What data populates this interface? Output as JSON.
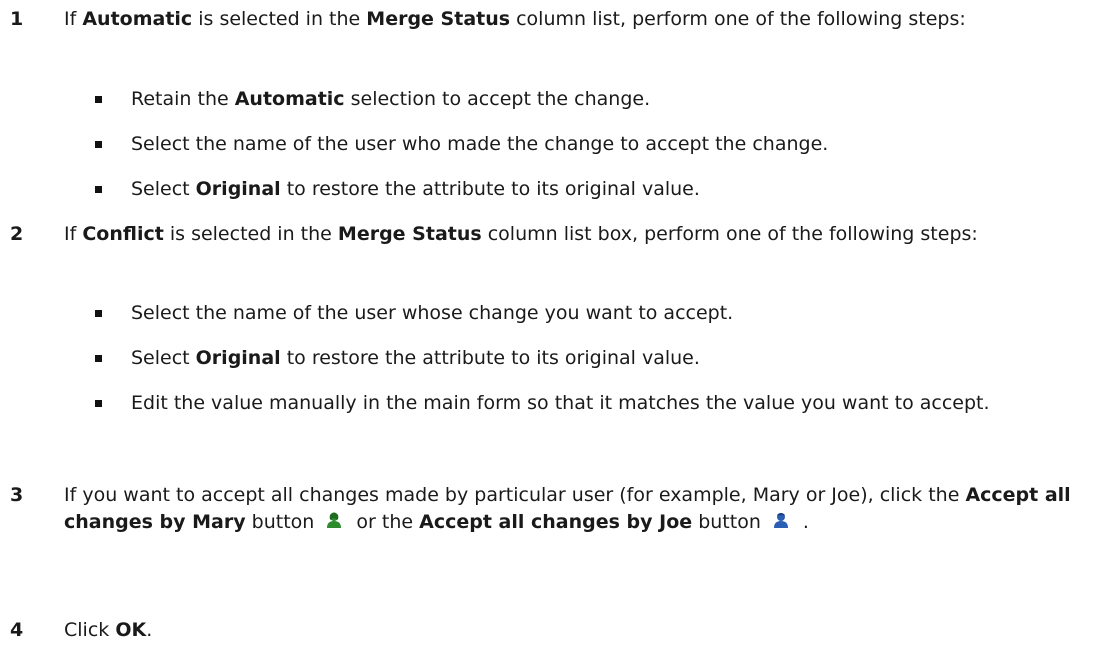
{
  "steps": [
    {
      "number": "1",
      "parts": [
        "If ",
        "Automatic",
        " is selected in the ",
        "Merge Status",
        " column list, perform one of the following steps:"
      ],
      "bullets": [
        {
          "parts": [
            "Retain the ",
            "Automatic",
            " selection to accept the change."
          ]
        },
        {
          "parts": [
            "Select the name of the user who made the change to accept the change."
          ]
        },
        {
          "parts": [
            "Select ",
            "Original",
            " to restore the attribute to its original value."
          ]
        }
      ]
    },
    {
      "number": "2",
      "parts": [
        "If ",
        "Conflict",
        " is selected in the ",
        "Merge Status",
        " column list box, perform one of the following steps:"
      ],
      "bullets": [
        {
          "parts": [
            "Select the name of the user whose change you want to accept."
          ]
        },
        {
          "parts": [
            "Select ",
            "Original",
            " to restore the attribute to its original value."
          ]
        },
        {
          "parts": [
            "Edit the value manually in the main form so that it matches the value you want to accept."
          ]
        }
      ]
    },
    {
      "number": "3",
      "parts": [
        "If you want to accept all changes made by particular user (for example, Mary or Joe), click the ",
        "Accept all changes by Mary",
        " button",
        " or the ",
        "Accept all changes by Joe",
        " button",
        " ."
      ],
      "icons": {
        "mary": "accept-all-changes-by-mary-icon",
        "joe": "accept-all-changes-by-joe-icon"
      }
    },
    {
      "number": "4",
      "parts": [
        "Click ",
        "OK",
        "."
      ]
    }
  ],
  "colors": {
    "mary_icon": "#2e8b2e",
    "joe_icon": "#2b5fb3"
  }
}
